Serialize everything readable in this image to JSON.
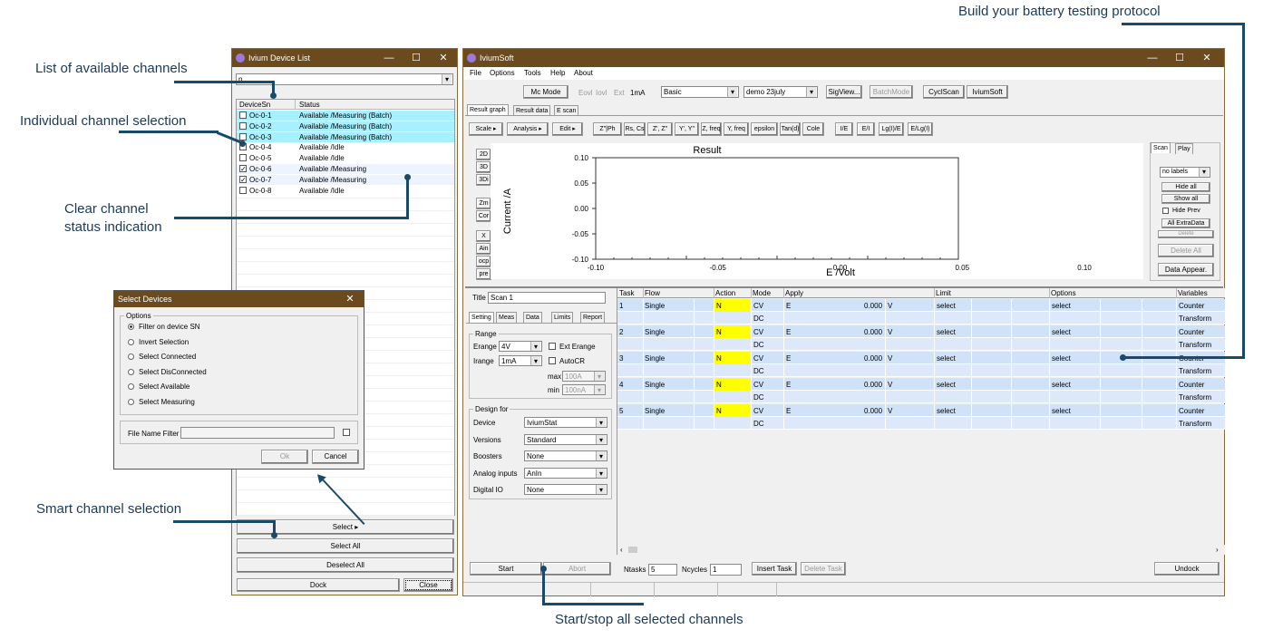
{
  "callouts": {
    "list_channels": "List of available channels",
    "individual": "Individual channel selection",
    "clear_status_1": "Clear channel",
    "clear_status_2": "status indication",
    "smart": "Smart channel selection",
    "start_stop": "Start/stop all selected channels",
    "protocol": "Build your battery testing protocol"
  },
  "device_list": {
    "title": "Ivium Device List",
    "filter_value": "n",
    "col_sn": "DeviceSn",
    "col_status": "Status",
    "rows": [
      {
        "sn": "Oc-0-1",
        "status": "Available /Measuring (Batch)",
        "checked": "",
        "hl": true
      },
      {
        "sn": "Oc-0-2",
        "status": "Available /Measuring (Batch)",
        "checked": "",
        "hl": true
      },
      {
        "sn": "Oc-0-3",
        "status": "Available /Measuring (Batch)",
        "checked": "",
        "hl": true
      },
      {
        "sn": "Oc-0-4",
        "status": "Available /Idle",
        "checked": "",
        "hl": false
      },
      {
        "sn": "Oc-0-5",
        "status": "Available /Idle",
        "checked": "",
        "hl": false
      },
      {
        "sn": "Oc-0-6",
        "status": "Available /Measuring",
        "checked": "✓",
        "hl": false
      },
      {
        "sn": "Oc-0-7",
        "status": "Available /Measuring",
        "checked": "✓",
        "hl": false
      },
      {
        "sn": "Oc-0-8",
        "status": "Available /Idle",
        "checked": "",
        "hl": false
      }
    ],
    "select": "Select ▸",
    "select_all": "Select All",
    "deselect_all": "Deselect All",
    "dock": "Dock",
    "close": "Close"
  },
  "select_devices": {
    "title": "Select Devices",
    "options_label": "Options",
    "options": [
      "Filter on device SN",
      "Invert Selection",
      "Select Connected",
      "Select DisConnected",
      "Select Available",
      "Select Measuring"
    ],
    "file_filter_label": "File Name Filter",
    "ok": "Ok",
    "cancel": "Cancel"
  },
  "iviumsoft": {
    "title": "IviumSoft",
    "menu": [
      "File",
      "Options",
      "Tools",
      "Help",
      "About"
    ],
    "toolbar": {
      "mc_mode": "Mc Mode",
      "eovl": "Eovl",
      "iovl": "Iovl",
      "ext": "Ext",
      "range": "1mA",
      "mode": "Basic",
      "file": "demo 23july",
      "sigview": "SigView...",
      "batchmode": "BatchMode",
      "cyclscan": "CyclScan",
      "iviumsoft": "IviumSoft"
    },
    "tabs": [
      "Result graph",
      "Result data",
      "E scan"
    ],
    "graph_toolbar": [
      "Scale ▸",
      "Analysis ▸",
      "Edit ▸",
      "Z\"|Ph",
      "Rs, Cs",
      "Z', Z\"",
      "Y', Y\"",
      "Z, freq",
      "Y, freq",
      "epsilon",
      "Tan(d)",
      "Cole",
      "I/E",
      "E/I",
      "Lg(I)/E",
      "E/Lg(I)"
    ],
    "side_buttons": [
      "2D",
      "3D",
      "3Di",
      "Zm",
      "Cor",
      "X",
      "Ain",
      "ocp",
      "pre"
    ],
    "chart_data": {
      "type": "line",
      "title": "Result",
      "xlabel": "E /Volt",
      "ylabel": "Current /A",
      "xlim": [
        -0.1,
        0.1
      ],
      "ylim": [
        -0.1,
        0.1
      ],
      "x_ticks": [
        "-0.10",
        "-0.05",
        "0.00",
        "0.05",
        "0.10"
      ],
      "y_ticks": [
        "0.10",
        "0.05",
        "0.00",
        "-0.05",
        "-0.10"
      ],
      "series": []
    },
    "right_panel": {
      "tab_scan": "Scan",
      "tab_play": "Play",
      "labels_select": "no labels",
      "hide_all": "Hide all",
      "show_all": "Show all",
      "hide_prev": "Hide Prev",
      "all_extra": "All ExtraData",
      "delete": "Delete",
      "delete_all": "Delete All",
      "data_appear": "Data Appear."
    },
    "title_label": "Title",
    "title_value": "Scan 1",
    "left_tabs": [
      "Setting",
      "Meas",
      "Data",
      "Limits",
      "Report"
    ],
    "range_group": "Range",
    "erange_label": "Erange",
    "erange": "4V",
    "ext_erange": "Ext Erange",
    "irange_label": "Irange",
    "irange": "1mA",
    "autocr": "AutoCR",
    "max_label": "max",
    "max": "100A",
    "min_label": "min",
    "min": "100nA",
    "design_group": "Design for",
    "design": [
      {
        "label": "Device",
        "value": "IviumStat"
      },
      {
        "label": "Versions",
        "value": "Standard"
      },
      {
        "label": "Boosters",
        "value": "None"
      },
      {
        "label": "Analog inputs",
        "value": "AnIn"
      },
      {
        "label": "Digital IO",
        "value": "None"
      }
    ],
    "task_headers": [
      "Task",
      "Flow",
      "Action",
      "Mode",
      "Apply",
      "Limit",
      "Options",
      "Variables"
    ],
    "tasks": [
      {
        "n": "1",
        "flow": "Single",
        "action": "N",
        "mode1": "CV",
        "mode2": "DC",
        "apply": "E",
        "val": "0.000",
        "unit": "V",
        "limit": "select",
        "opt": "select",
        "v1": "Counter",
        "v2": "Transform"
      },
      {
        "n": "2",
        "flow": "Single",
        "action": "N",
        "mode1": "CV",
        "mode2": "DC",
        "apply": "E",
        "val": "0.000",
        "unit": "V",
        "limit": "select",
        "opt": "select",
        "v1": "Counter",
        "v2": "Transform"
      },
      {
        "n": "3",
        "flow": "Single",
        "action": "N",
        "mode1": "CV",
        "mode2": "DC",
        "apply": "E",
        "val": "0.000",
        "unit": "V",
        "limit": "select",
        "opt": "select",
        "v1": "Counter",
        "v2": "Transform"
      },
      {
        "n": "4",
        "flow": "Single",
        "action": "N",
        "mode1": "CV",
        "mode2": "DC",
        "apply": "E",
        "val": "0.000",
        "unit": "V",
        "limit": "select",
        "opt": "select",
        "v1": "Counter",
        "v2": "Transform"
      },
      {
        "n": "5",
        "flow": "Single",
        "action": "N",
        "mode1": "CV",
        "mode2": "DC",
        "apply": "E",
        "val": "0.000",
        "unit": "V",
        "limit": "select",
        "opt": "select",
        "v1": "Counter",
        "v2": "Transform"
      }
    ],
    "start": "Start",
    "abort": "Abort",
    "ntasks_label": "Ntasks",
    "ntasks": "5",
    "ncycles_label": "Ncycles",
    "ncycles": "1",
    "insert_task": "Insert Task",
    "delete_task": "Delete Task",
    "undock": "Undock"
  }
}
